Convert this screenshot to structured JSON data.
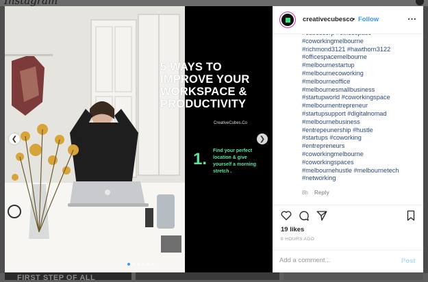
{
  "app": {
    "logo_text": "Instagram"
  },
  "post": {
    "slide": {
      "headline_lines": [
        "5 WAYS TO",
        "IMPROVE YOUR",
        "WORKSPACE &",
        "PRODUCTIVITY"
      ],
      "brand": "CreativeCubes.Co",
      "step_number": "1.",
      "step_lines": [
        "Find your perfect",
        "location &  give",
        "yourself a morning",
        "stretch ."
      ]
    },
    "carousel": {
      "dot_count": 6,
      "active_index": 0
    },
    "background_strip_text": "FIRST STEP OF ALL"
  },
  "header": {
    "username": "creativecubesco",
    "separator": "•",
    "follow_label": "Follow",
    "more_icon": "⋯"
  },
  "caption": {
    "hashtags": [
      "#cubescorp #officespace",
      "#coworkingmelbourne",
      "#richmond3121 #hawthorn3122",
      "#officespacemelbourne",
      "#melbournestartup",
      "#melbournecoworking",
      "#melbourneoffice",
      "#melbournesmallbusiness",
      "#startupworld #coworkingspace",
      "#melbournentrepreneur",
      "#startupsupport #digitalnomad",
      "#melbournebusiness",
      "#entrepeunership #hustle",
      "#startups #coworking",
      "#entrepreneurs",
      "#coworkingmelbourne",
      "#coworkingspaces",
      "#melbournehustle #melbournetech",
      "#networking"
    ],
    "age": "8h",
    "reply_label": "Reply"
  },
  "actions": {
    "icons": [
      "heart-icon",
      "comment-icon",
      "share-icon",
      "bookmark-icon"
    ],
    "likes": "19 likes",
    "time_ago": "8 HOURS AGO"
  },
  "comment": {
    "placeholder": "Add a comment...",
    "post_label": "Post"
  },
  "colors": {
    "accent": "#3897f0",
    "slide_green": "#5ee3a0",
    "hashtag": "#2c4a7a"
  }
}
